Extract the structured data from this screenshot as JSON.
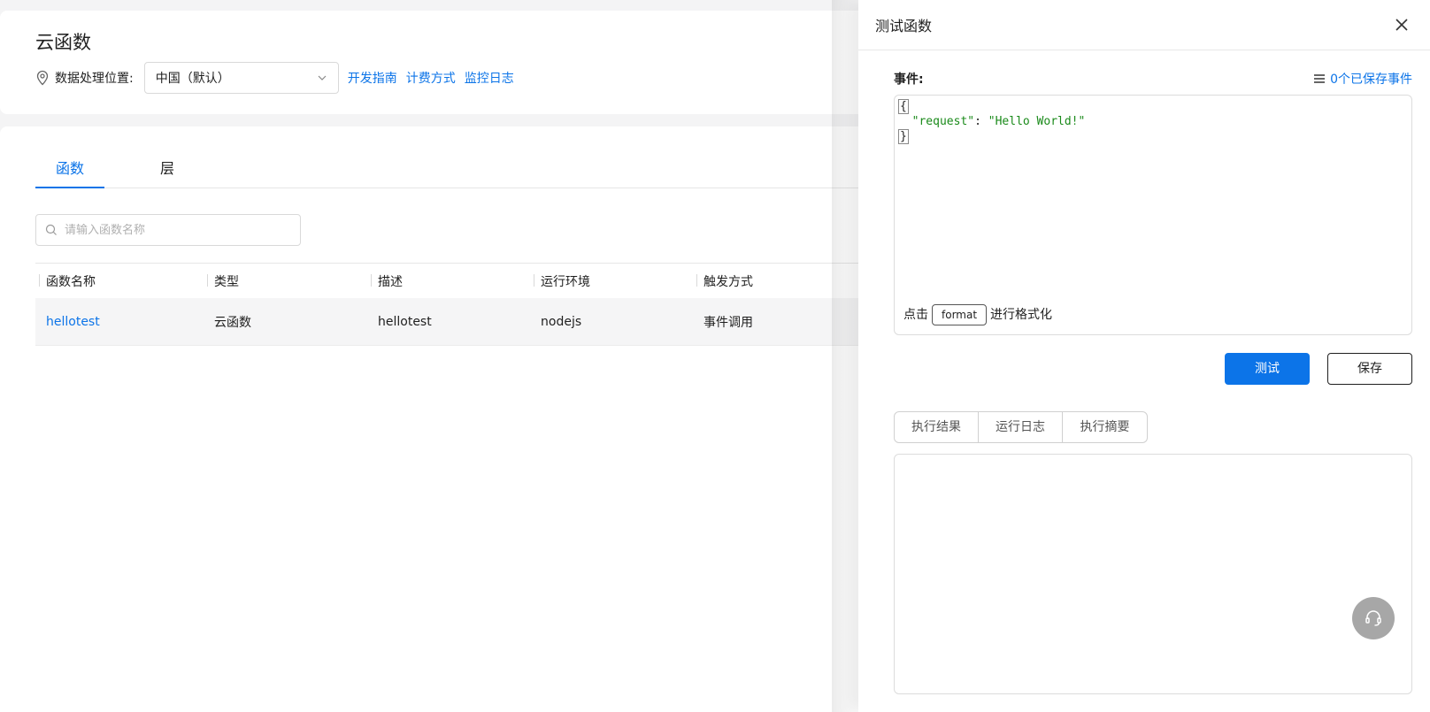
{
  "page": {
    "title": "云函数",
    "location_label": "数据处理位置:",
    "location_value": "中国（默认）",
    "links": [
      "开发指南",
      "计费方式",
      "监控日志"
    ]
  },
  "tabs": [
    {
      "label": "函数",
      "active": true
    },
    {
      "label": "层",
      "active": false
    }
  ],
  "search": {
    "placeholder": "请输入函数名称",
    "value": ""
  },
  "table": {
    "columns": [
      "函数名称",
      "类型",
      "描述",
      "运行环境",
      "触发方式"
    ],
    "rows": [
      {
        "name": "hellotest",
        "type": "云函数",
        "description": "hellotest",
        "runtime": "nodejs",
        "trigger": "事件调用"
      }
    ]
  },
  "drawer": {
    "title": "测试函数",
    "event_label": "事件:",
    "saved_events": "0个已保存事件",
    "editor": {
      "open_brace": "{",
      "key": "\"request\"",
      "colon": ": ",
      "value": "\"Hello World!\"",
      "close_brace": "}"
    },
    "format_prefix": "点击",
    "format_button": "format",
    "format_suffix": "进行格式化",
    "test_button": "测试",
    "save_button": "保存",
    "result_tabs": [
      "执行结果",
      "运行日志",
      "执行摘要"
    ]
  },
  "colors": {
    "accent": "#0c74e8",
    "json_string": "#1a8a1a",
    "fab": "#a7a7a7"
  }
}
